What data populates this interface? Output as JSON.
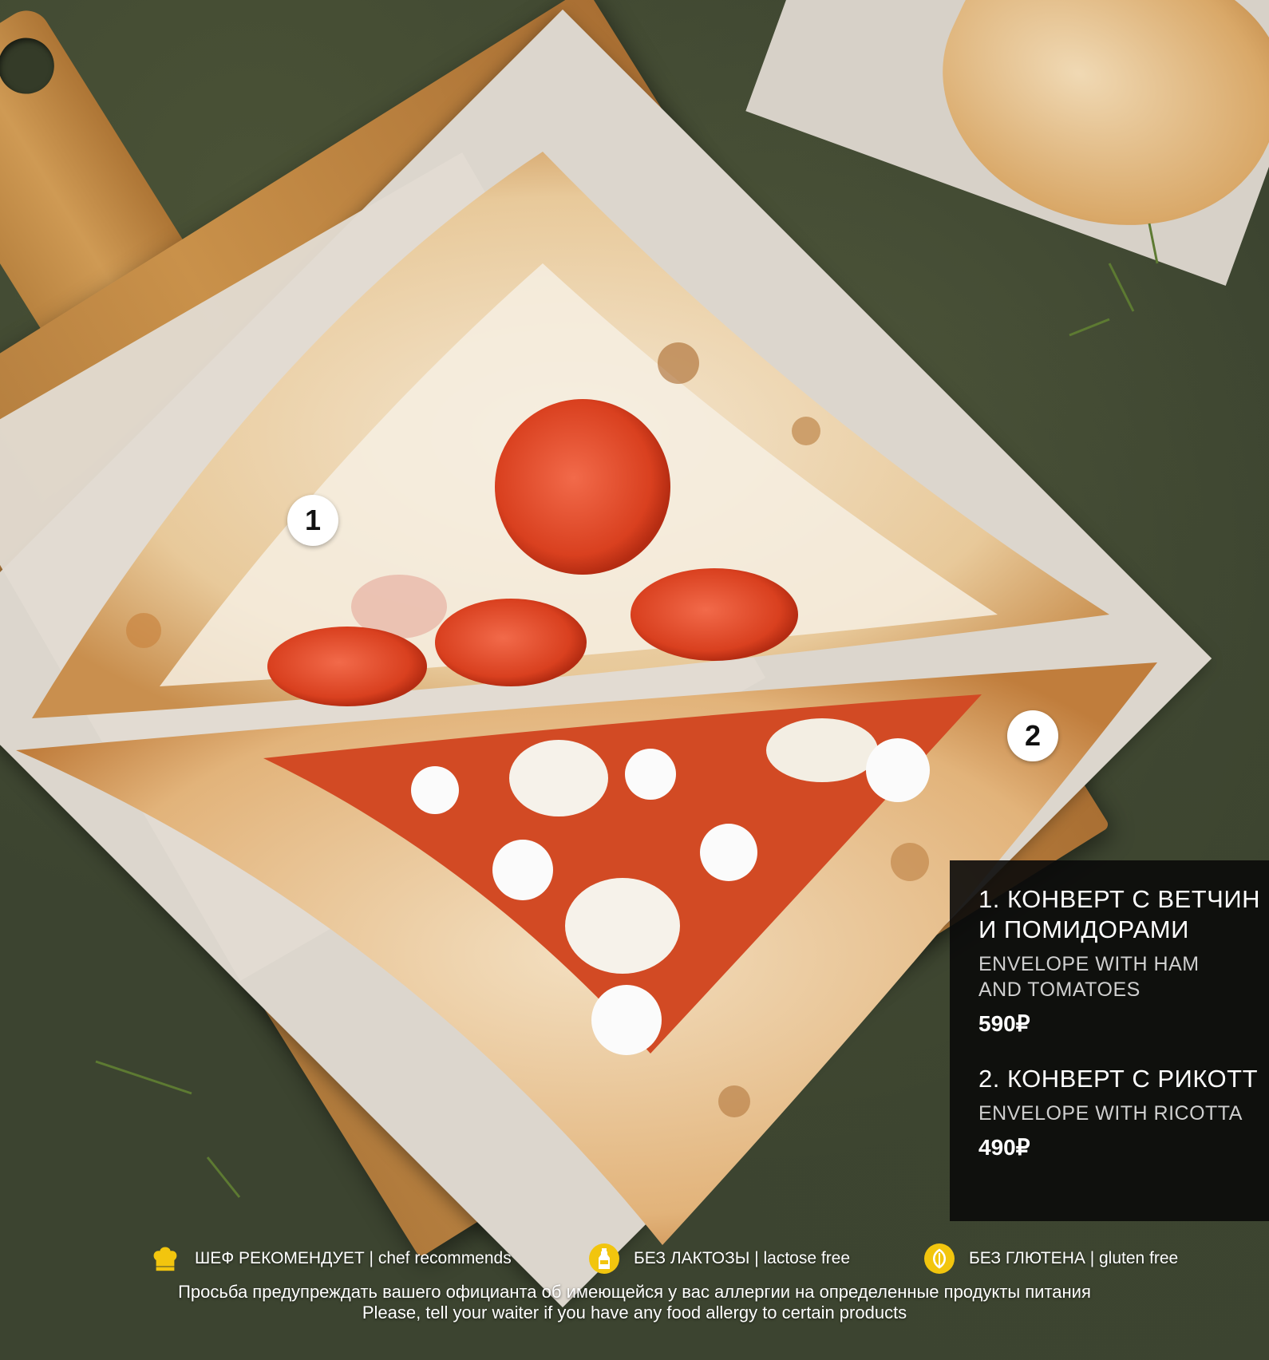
{
  "badges": {
    "first": "1",
    "second": "2"
  },
  "menu": {
    "items": [
      {
        "name_ru": "1. КОНВЕРТ С ВЕТЧИН\nИ ПОМИДОРАМИ",
        "name_en": "ENVELOPE WITH HAM\nAND TOMATOES",
        "price": "590₽"
      },
      {
        "name_ru": "2. КОНВЕРТ С РИКОТТ",
        "name_en": "ENVELOPE WITH RICOTTA",
        "price": "490₽"
      }
    ]
  },
  "legend": {
    "chef": {
      "label": "ШЕФ РЕКОМЕНДУЕТ | chef recommends",
      "icon": "chef-hat-icon"
    },
    "lactose": {
      "label": "БЕЗ ЛАКТОЗЫ | lactose free",
      "icon": "milk-bottle-icon"
    },
    "gluten": {
      "label": "БЕЗ ГЛЮТЕНА | gluten free",
      "icon": "wheat-leaf-icon"
    },
    "icon_color": "#f2c50e"
  },
  "notice": {
    "ru": "Просьба предупреждать вашего официанта об имеющейся у вас аллергии на определенные продукты питания",
    "en": "Please, tell your waiter if you have any food allergy to certain products"
  }
}
